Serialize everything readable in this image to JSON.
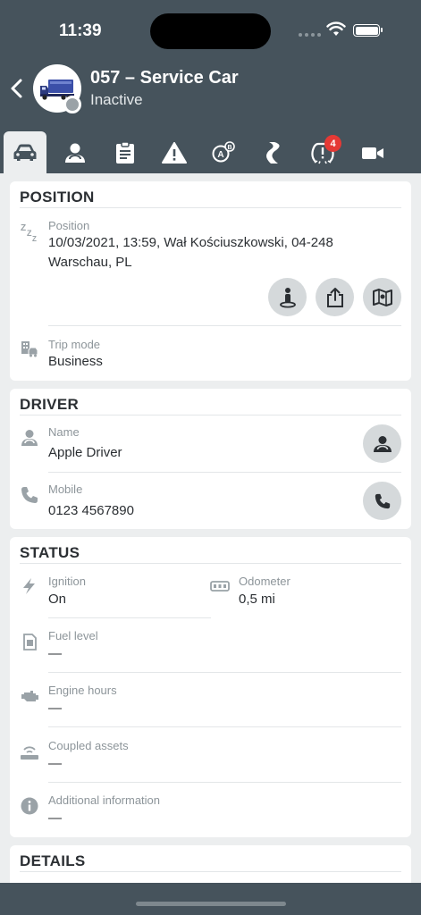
{
  "status_bar": {
    "time": "11:39"
  },
  "header": {
    "title": "057 – Service Car",
    "subtitle": "Inactive"
  },
  "tabs": [
    {
      "name": "vehicle",
      "icon": "car-icon",
      "active": true
    },
    {
      "name": "driver",
      "icon": "driver-icon"
    },
    {
      "name": "tasks",
      "icon": "clipboard-icon"
    },
    {
      "name": "alerts",
      "icon": "warning-icon"
    },
    {
      "name": "route",
      "icon": "route-ab-icon"
    },
    {
      "name": "trips",
      "icon": "road-icon"
    },
    {
      "name": "tires",
      "icon": "tire-pressure-icon",
      "badge": "4"
    },
    {
      "name": "camera",
      "icon": "video-camera-icon"
    }
  ],
  "position_card": {
    "title": "POSITION",
    "position_label": "Position",
    "position_line1": "10/03/2021, 13:59, Wał Kościuszkowski, 04-248",
    "position_line2": "Warschau, PL",
    "trip_mode_label": "Trip mode",
    "trip_mode_value": "Business"
  },
  "driver_card": {
    "title": "DRIVER",
    "name_label": "Name",
    "name_value": "Apple Driver",
    "mobile_label": "Mobile",
    "mobile_value": "0123 4567890"
  },
  "status_card": {
    "title": "STATUS",
    "ignition_label": "Ignition",
    "ignition_value": "On",
    "odometer_label": "Odometer",
    "odometer_value": "0,5 mi",
    "fuel_label": "Fuel level",
    "fuel_value": "—",
    "engine_label": "Engine hours",
    "engine_value": "—",
    "coupled_label": "Coupled assets",
    "coupled_value": "—",
    "additional_label": "Additional information",
    "additional_value": "—"
  },
  "details_card": {
    "title": "DETAILS"
  },
  "colors": {
    "header_bg": "#46535C",
    "page_bg": "#ECEEEF",
    "badge": "#E53935",
    "icon_gray": "#9aa2a7",
    "button_bg": "#D5D9DB"
  }
}
